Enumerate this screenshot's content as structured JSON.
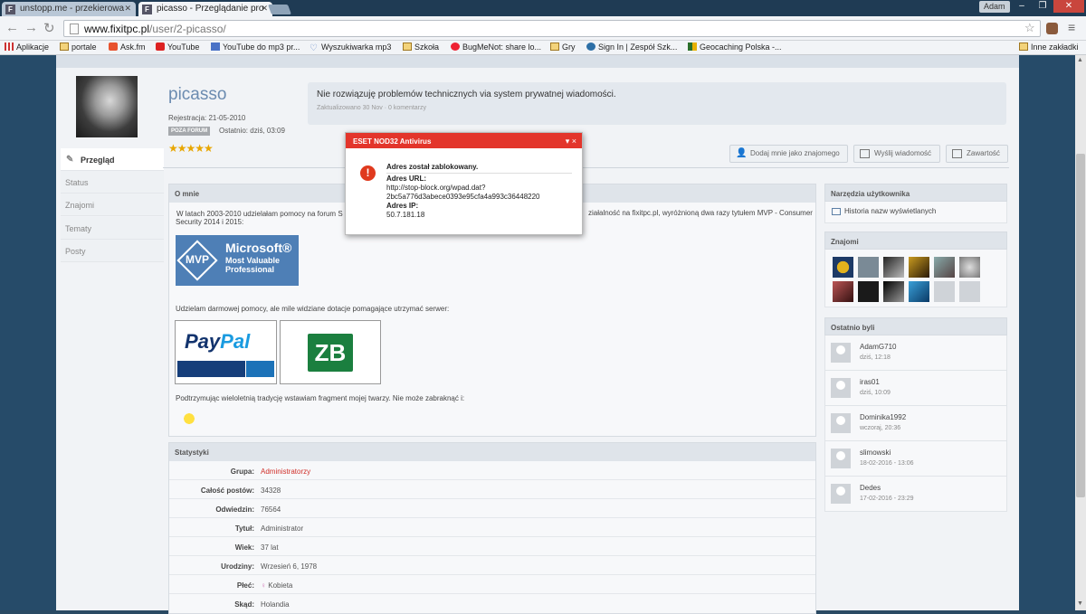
{
  "browser": {
    "tabs": [
      {
        "title": "unstopp.me - przekierowa",
        "favicon": "F"
      },
      {
        "title": "picasso - Przeglądanie pro",
        "favicon": "F"
      }
    ],
    "profile_name": "Adam",
    "url_host": "www.fixitpc.pl",
    "url_path": "/user/2-picasso/",
    "bookmarks": [
      "Aplikacje",
      "portale",
      "Ask.fm",
      "YouTube",
      "YouTube do mp3 pr...",
      "Wyszukiwarka mp3",
      "Szkoła",
      "BugMeNot: share lo...",
      "Gry",
      "Sign In | Zespół Szk...",
      "Geocaching Polska -..."
    ],
    "other_bookmarks": "Inne zakładki"
  },
  "profile": {
    "username": "picasso",
    "registered": "Rejestracja: 21-05-2010",
    "offline_badge": "POZA FORUM",
    "last_active": "Ostatnio: dziś, 03:09",
    "stars": "★★★★★",
    "status_text": "Nie rozwiązuję problemów technicznych via system prywatnej wiadomości.",
    "status_meta": "Zaktualizowano 30 Nov · 0 komentarzy"
  },
  "sidenav": [
    "Przegląd",
    "Status",
    "Znajomi",
    "Tematy",
    "Posty"
  ],
  "actions": [
    "Dodaj mnie jako znajomego",
    "Wyślij wiadomość",
    "Zawartość"
  ],
  "about": {
    "title": "O mnie",
    "text_left": "W latach 2003-2010 udzielałam pomocy na forum S",
    "text_right": "ziałalność na fixitpc.pl, wyróżnioną dwa razy tytułem MVP - Consumer",
    "text_line2": "Security 2014 i 2015:",
    "mvp_microsoft": "Microsoft®",
    "mvp_line1": "Most Valuable",
    "mvp_line2": "Professional",
    "mvp_abbr": "MVP",
    "donation_text": "Udzielam darmowej pomocy, ale mile widziane dotacje pomagające utrzymać serwer:",
    "paypal_a": "Pay",
    "paypal_b": "Pal",
    "zb_logo": "ZB",
    "tradition_text": "Podtrzymując wieloletnią tradycję wstawiam fragment mojej twarzy. Nie może zabraknąć i:"
  },
  "stats": {
    "title": "Statystyki",
    "rows": [
      {
        "label": "Grupa:",
        "value": "Administratorzy",
        "color": "#d0302a"
      },
      {
        "label": "Całość postów:",
        "value": "34328"
      },
      {
        "label": "Odwiedzin:",
        "value": "76564"
      },
      {
        "label": "Tytuł:",
        "value": "Administrator"
      },
      {
        "label": "Wiek:",
        "value": "37 lat"
      },
      {
        "label": "Urodziny:",
        "value": "Wrzesień 6, 1978"
      },
      {
        "label": "Płeć:",
        "value": "Kobieta"
      },
      {
        "label": "Skąd:",
        "value": "Holandia"
      }
    ]
  },
  "tools": {
    "title": "Narzędzia użytkownika",
    "item": "Historia nazw wyświetlanych"
  },
  "friends": {
    "title": "Znajomi"
  },
  "recent": {
    "title": "Ostatnio byli",
    "users": [
      {
        "name": "AdamG710",
        "time": "dziś, 12:18"
      },
      {
        "name": "iras01",
        "time": "dziś, 10:09"
      },
      {
        "name": "Dominika1992",
        "time": "wczoraj, 20:36"
      },
      {
        "name": "slimowski",
        "time": "18-02-2016 - 13:06"
      },
      {
        "name": "Dedes",
        "time": "17-02-2016 - 23:29"
      }
    ]
  },
  "eset": {
    "title": "ESET NOD32 Antivirus",
    "controls": "▾ ×",
    "heading": "Adres został zablokowany.",
    "url_label": "Adres URL:",
    "url_value": "http://stop-block.org/wpad.dat?",
    "url_value2": "2bc5a776d3abece0393e95cfa4a993c36448220",
    "ip_label": "Adres IP:",
    "ip_value": "50.7.181.18"
  }
}
